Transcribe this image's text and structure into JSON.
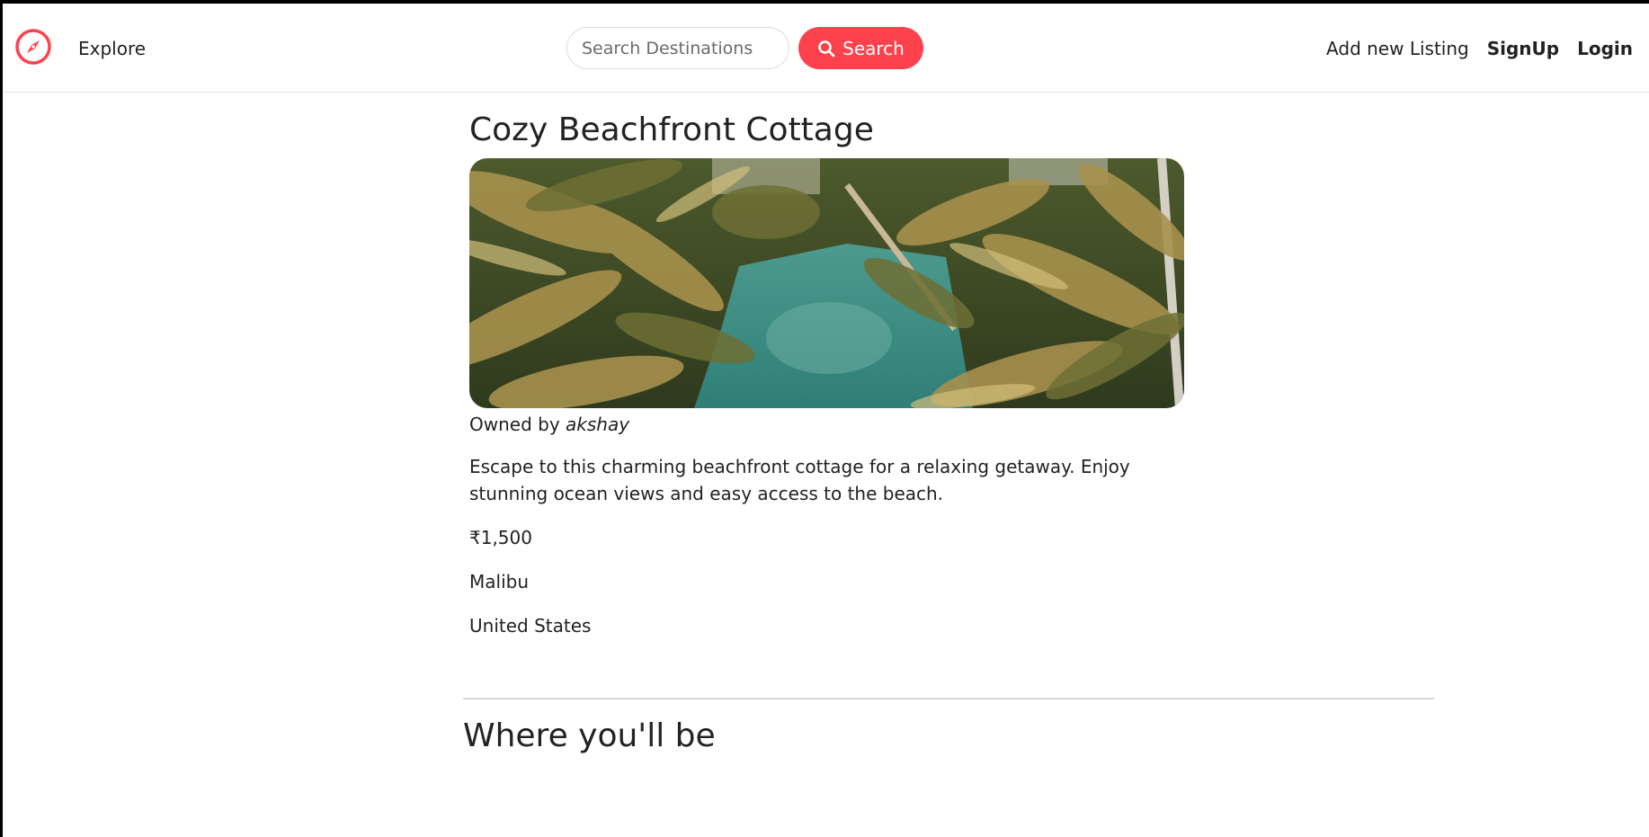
{
  "navbar": {
    "brand_icon": "compass-icon",
    "brand_color": "#fe424d",
    "explore_label": "Explore",
    "search_placeholder": "Search Destinations",
    "search_button_label": "Search",
    "search_button_icon": "search-icon",
    "add_listing_label": "Add new Listing",
    "signup_label": "SignUp",
    "login_label": "Login"
  },
  "listing": {
    "title": "Cozy Beachfront Cottage",
    "owner_prefix": "Owned by",
    "owner_name": "akshay",
    "description": "Escape to this charming beachfront cottage for a relaxing getaway. Enjoy stunning ocean views and easy access to the beach.",
    "price": "₹1,500",
    "location": "Malibu",
    "country": "United States"
  },
  "map_section": {
    "title": "Where you'll be"
  },
  "colors": {
    "accent": "#fe424d",
    "text": "#222222",
    "divider": "#d8d8d8"
  }
}
